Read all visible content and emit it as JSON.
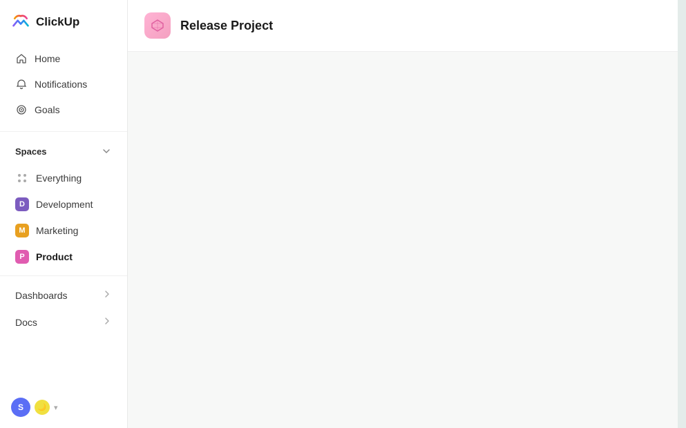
{
  "logo": {
    "text": "ClickUp"
  },
  "nav": {
    "home_label": "Home",
    "notifications_label": "Notifications",
    "goals_label": "Goals"
  },
  "spaces": {
    "section_label": "Spaces",
    "everything_label": "Everything",
    "items": [
      {
        "id": "development",
        "label": "Development",
        "initials": "D",
        "color_class": "dev"
      },
      {
        "id": "marketing",
        "label": "Marketing",
        "initials": "M",
        "color_class": "mkt"
      },
      {
        "id": "product",
        "label": "Product",
        "initials": "P",
        "color_class": "prod",
        "active": true
      }
    ]
  },
  "collapsibles": [
    {
      "id": "dashboards",
      "label": "Dashboards"
    },
    {
      "id": "docs",
      "label": "Docs"
    }
  ],
  "project": {
    "title": "Release Project"
  },
  "user": {
    "initials": "S"
  }
}
